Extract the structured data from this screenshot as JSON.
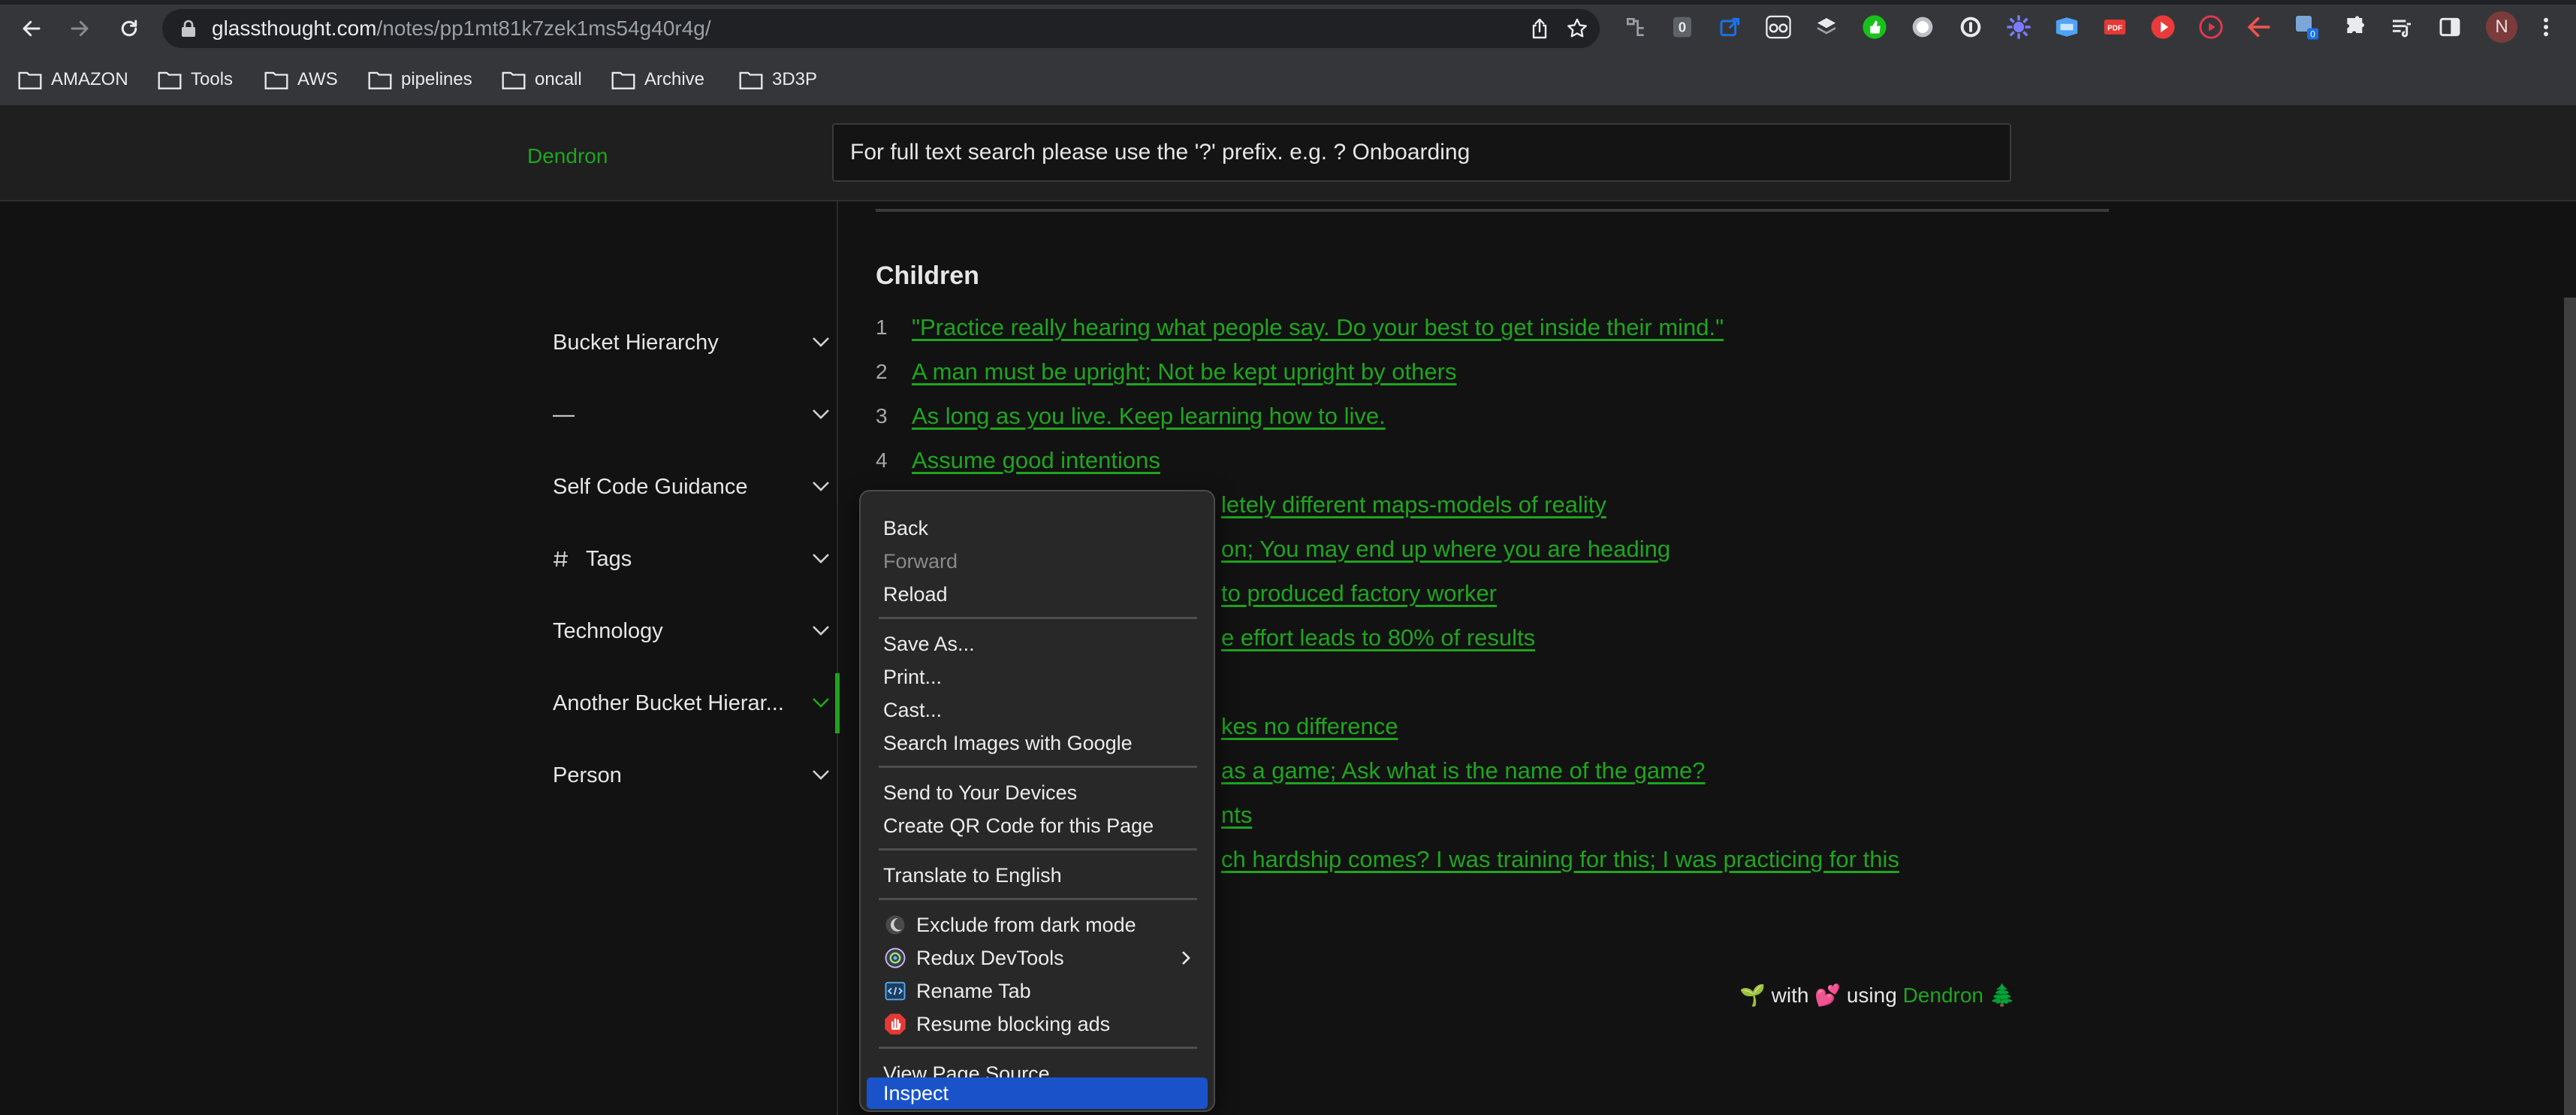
{
  "browser": {
    "url_host": "glassthought.com",
    "url_path": "/notes/pp1mt81k7zek1ms54g40r4g/",
    "profile_initial": "N",
    "extension_badge_count": "0",
    "extension_icons": [
      "tree-icon",
      "zero-icon",
      "share-icon",
      "glasses-icon",
      "checker-icon",
      "thumbs-up-icon",
      "circle-icon",
      "onepassword-icon",
      "gear-flower-icon",
      "browser-window-icon",
      "red-badge-icon",
      "play-icon",
      "circle-play-icon",
      "back-arrow-icon",
      "badge-puzzle-icon",
      "puzzle-icon",
      "playlist-icon",
      "side-panel-icon"
    ],
    "bookmarks": [
      "AMAZON",
      "Tools",
      "AWS",
      "pipelines",
      "oncall",
      "Archive",
      "3D3P"
    ]
  },
  "app": {
    "logo": "Dendron",
    "search_placeholder": "For full text search please use the '?' prefix. e.g. ? Onboarding"
  },
  "sidebar": {
    "items": [
      {
        "label": "Bucket Hierarchy"
      },
      {
        "label": "—"
      },
      {
        "label": "Self Code Guidance"
      },
      {
        "label": "Tags"
      },
      {
        "label": "Technology"
      },
      {
        "label": "Another Bucket Hierar..."
      },
      {
        "label": "Person"
      }
    ]
  },
  "content": {
    "children_title": "Children",
    "children": [
      {
        "num": "1",
        "text": "\"Practice really hearing what people say. Do your best to get inside their mind.\""
      },
      {
        "num": "2",
        "text": "A man must be upright; Not be kept upright by others"
      },
      {
        "num": "3",
        "text": "As long as you live. Keep learning how to live."
      },
      {
        "num": "4",
        "text": "Assume good intentions"
      },
      {
        "num": "",
        "text": "letely different maps-models of reality"
      },
      {
        "num": "",
        "text": "on; You may end up where you are heading"
      },
      {
        "num": "",
        "text": "to produced factory worker"
      },
      {
        "num": "",
        "text": "e effort leads to 80% of results"
      },
      {
        "num": "",
        "text": "kes no difference"
      },
      {
        "num": "",
        "text": "as a game; Ask what is the name of the game?"
      },
      {
        "num": "",
        "text": "nts"
      },
      {
        "num": "",
        "text": "ch hardship comes? I was training for this; I was practicing for this"
      }
    ],
    "footer": {
      "prefix": "🌱 with 💕 using ",
      "link": "Dendron",
      "suffix": " 🌲"
    }
  },
  "context_menu": {
    "groups": [
      [
        {
          "label": "Back",
          "disabled": false
        },
        {
          "label": "Forward",
          "disabled": true
        },
        {
          "label": "Reload",
          "disabled": false
        }
      ],
      [
        {
          "label": "Save As..."
        },
        {
          "label": "Print..."
        },
        {
          "label": "Cast..."
        },
        {
          "label": "Search Images with Google"
        }
      ],
      [
        {
          "label": "Send to Your Devices"
        },
        {
          "label": "Create QR Code for this Page"
        }
      ],
      [
        {
          "label": "Translate to English"
        }
      ],
      [
        {
          "label": "Exclude from dark mode",
          "icon": "moon-icon"
        },
        {
          "label": "Redux DevTools",
          "icon": "redux-icon",
          "submenu": true
        },
        {
          "label": "Rename Tab",
          "icon": "code-tab-icon"
        },
        {
          "label": "Resume blocking ads",
          "icon": "stop-hand-icon"
        }
      ],
      [
        {
          "label": "View Page Source"
        },
        {
          "label": "Inspect",
          "selected": true
        }
      ]
    ]
  },
  "colors": {
    "accent_green": "#1fa51f",
    "menu_selected": "#1a53c9",
    "background": "#121212"
  }
}
